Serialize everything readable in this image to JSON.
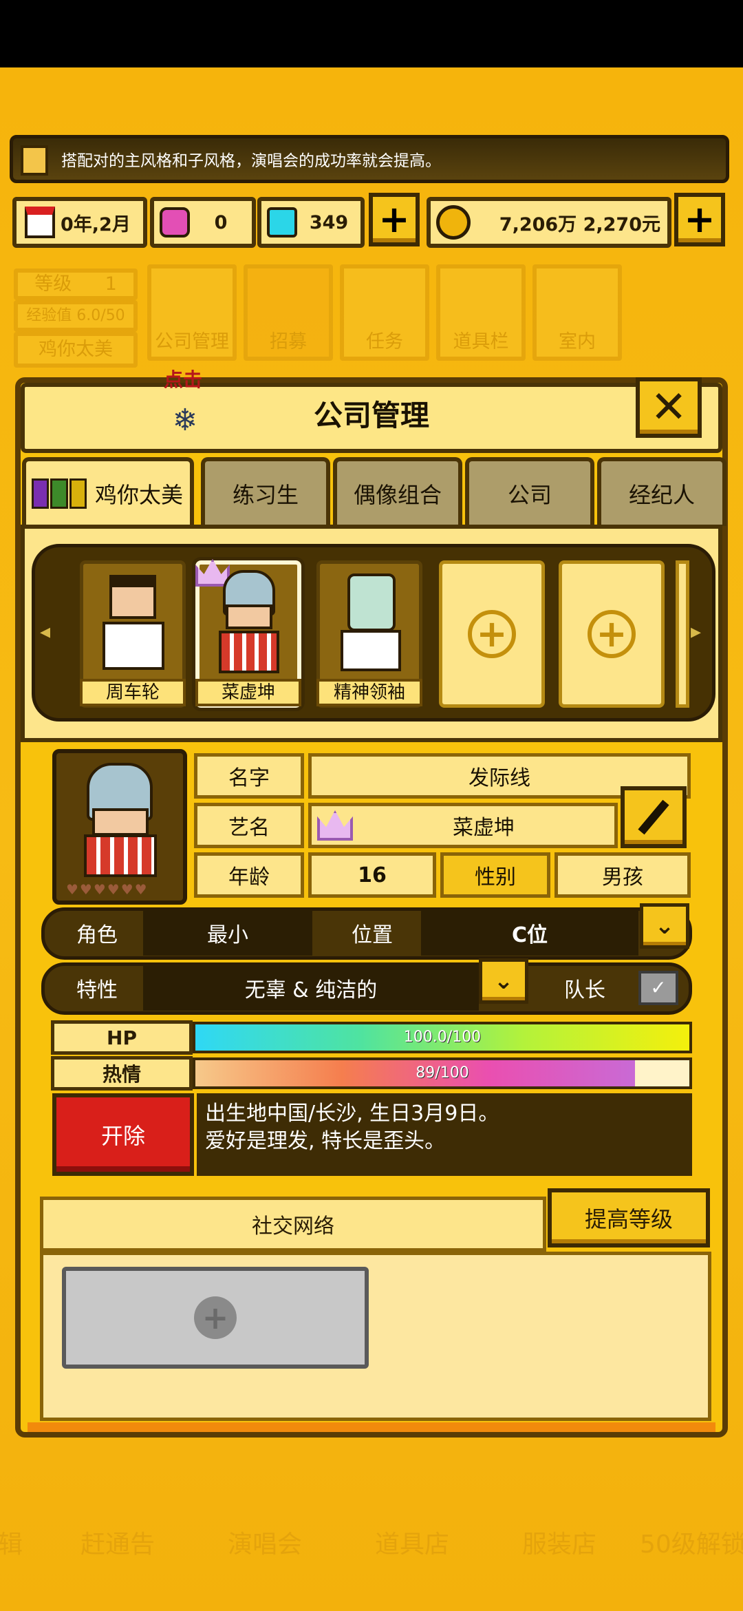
{
  "tip": {
    "text": "搭配对的主风格和子风格，演唱会的成功率就会提高。",
    "icon": "scroll-icon"
  },
  "resources": {
    "date": "0年,2月",
    "pink_gem": "0",
    "blue_gem": "349",
    "money": "7,206万 2,270元",
    "plus_symbol": "+"
  },
  "background_hud": {
    "level_label": "等级",
    "level_value": "1",
    "exp_label": "经验值 6.0/50",
    "company_name": "鸡你太美",
    "menu": [
      "公司管理",
      "招募",
      "任务",
      "道具栏",
      "室内"
    ],
    "bottom_menu": [
      "辑",
      "赶通告",
      "演唱会",
      "道具店",
      "服装店",
      "50级解锁"
    ]
  },
  "tooltip": {
    "label": "点击"
  },
  "panel": {
    "title": "公司管理",
    "close": "✕",
    "tabs": [
      "鸡你太美",
      "练习生",
      "偶像组合",
      "公司",
      "经纪人"
    ]
  },
  "roster": {
    "members": [
      "周车轮",
      "菜虚坤",
      "精神领袖"
    ],
    "empty_plus": "+",
    "arrow_left": "◂",
    "arrow_right": "▸"
  },
  "profile": {
    "name_label": "名字",
    "name_value": "发际线",
    "stage_label": "艺名",
    "stage_value": "菜虚坤",
    "age_label": "年龄",
    "age_value": "16",
    "gender_label": "性别",
    "gender_value": "男孩",
    "role_label": "角色",
    "role_value": "最小",
    "position_label": "位置",
    "position_value": "C位",
    "trait_label": "特性",
    "trait_value": "无辜 & 纯洁的",
    "leader_label": "队长",
    "dropdown_symbol": "⌄",
    "hp_label": "HP",
    "hp_text": "100.0/100",
    "hp_fraction": 1.0,
    "passion_label": "热情",
    "passion_text": "89/100",
    "passion_fraction": 0.89,
    "fire_label": "开除",
    "bio_line1": "出生地中国/长沙, 生日3月9日。",
    "bio_line2": "爱好是理发, 特长是歪头。"
  },
  "social": {
    "header": "社交网络",
    "level_up": "提高等级",
    "add_symbol": "+"
  },
  "colors": {
    "accent": "#f8c20c",
    "dark_brown": "#3e2c05",
    "cream": "#fde58b",
    "fire_red": "#d91f1a"
  }
}
